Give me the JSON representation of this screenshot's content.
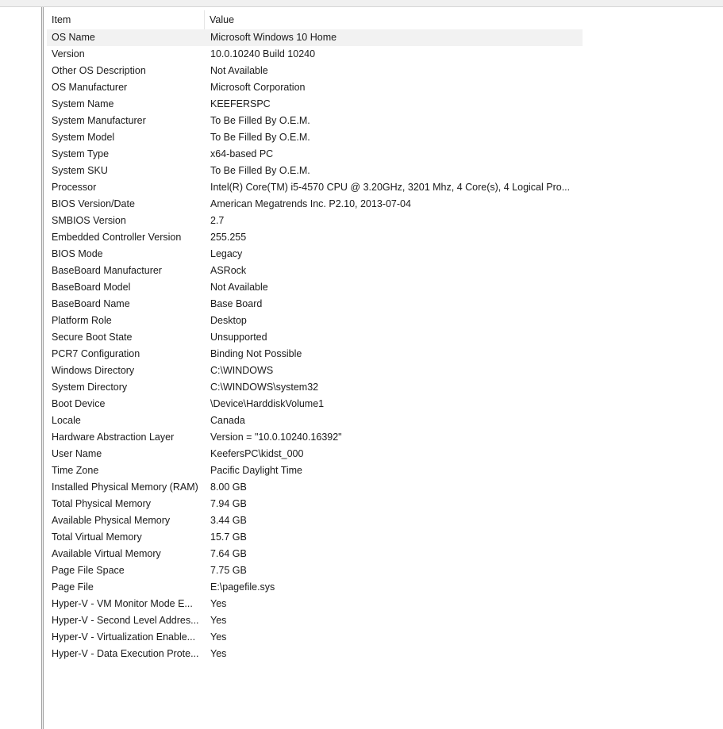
{
  "columns": {
    "item": "Item",
    "value": "Value"
  },
  "rows": [
    {
      "item": "OS Name",
      "value": "Microsoft Windows 10 Home"
    },
    {
      "item": "Version",
      "value": "10.0.10240 Build 10240"
    },
    {
      "item": "Other OS Description",
      "value": "Not Available"
    },
    {
      "item": "OS Manufacturer",
      "value": "Microsoft Corporation"
    },
    {
      "item": "System Name",
      "value": "KEEFERSPC"
    },
    {
      "item": "System Manufacturer",
      "value": "To Be Filled By O.E.M."
    },
    {
      "item": "System Model",
      "value": "To Be Filled By O.E.M."
    },
    {
      "item": "System Type",
      "value": "x64-based PC"
    },
    {
      "item": "System SKU",
      "value": "To Be Filled By O.E.M."
    },
    {
      "item": "Processor",
      "value": "Intel(R) Core(TM) i5-4570 CPU @ 3.20GHz, 3201 Mhz, 4 Core(s), 4 Logical Pro..."
    },
    {
      "item": "BIOS Version/Date",
      "value": "American Megatrends Inc. P2.10, 2013-07-04"
    },
    {
      "item": "SMBIOS Version",
      "value": "2.7"
    },
    {
      "item": "Embedded Controller Version",
      "value": "255.255"
    },
    {
      "item": "BIOS Mode",
      "value": "Legacy"
    },
    {
      "item": "BaseBoard Manufacturer",
      "value": "ASRock"
    },
    {
      "item": "BaseBoard Model",
      "value": "Not Available"
    },
    {
      "item": "BaseBoard Name",
      "value": "Base Board"
    },
    {
      "item": "Platform Role",
      "value": "Desktop"
    },
    {
      "item": "Secure Boot State",
      "value": "Unsupported"
    },
    {
      "item": "PCR7 Configuration",
      "value": "Binding Not Possible"
    },
    {
      "item": "Windows Directory",
      "value": "C:\\WINDOWS"
    },
    {
      "item": "System Directory",
      "value": "C:\\WINDOWS\\system32"
    },
    {
      "item": "Boot Device",
      "value": "\\Device\\HarddiskVolume1"
    },
    {
      "item": "Locale",
      "value": "Canada"
    },
    {
      "item": "Hardware Abstraction Layer",
      "value": "Version = \"10.0.10240.16392\""
    },
    {
      "item": "User Name",
      "value": "KeefersPC\\kidst_000"
    },
    {
      "item": "Time Zone",
      "value": "Pacific Daylight Time"
    },
    {
      "item": "Installed Physical Memory (RAM)",
      "value": "8.00 GB"
    },
    {
      "item": "Total Physical Memory",
      "value": "7.94 GB"
    },
    {
      "item": "Available Physical Memory",
      "value": "3.44 GB"
    },
    {
      "item": "Total Virtual Memory",
      "value": "15.7 GB"
    },
    {
      "item": "Available Virtual Memory",
      "value": "7.64 GB"
    },
    {
      "item": "Page File Space",
      "value": "7.75 GB"
    },
    {
      "item": "Page File",
      "value": "E:\\pagefile.sys"
    },
    {
      "item": "Hyper-V - VM Monitor Mode E...",
      "value": "Yes"
    },
    {
      "item": "Hyper-V - Second Level Addres...",
      "value": "Yes"
    },
    {
      "item": "Hyper-V - Virtualization Enable...",
      "value": "Yes"
    },
    {
      "item": "Hyper-V - Data Execution Prote...",
      "value": "Yes"
    }
  ],
  "selected_row_index": 0,
  "colors": {
    "selected_row_bg": "#f2f2f2",
    "splitter": "#a0a0a0"
  }
}
